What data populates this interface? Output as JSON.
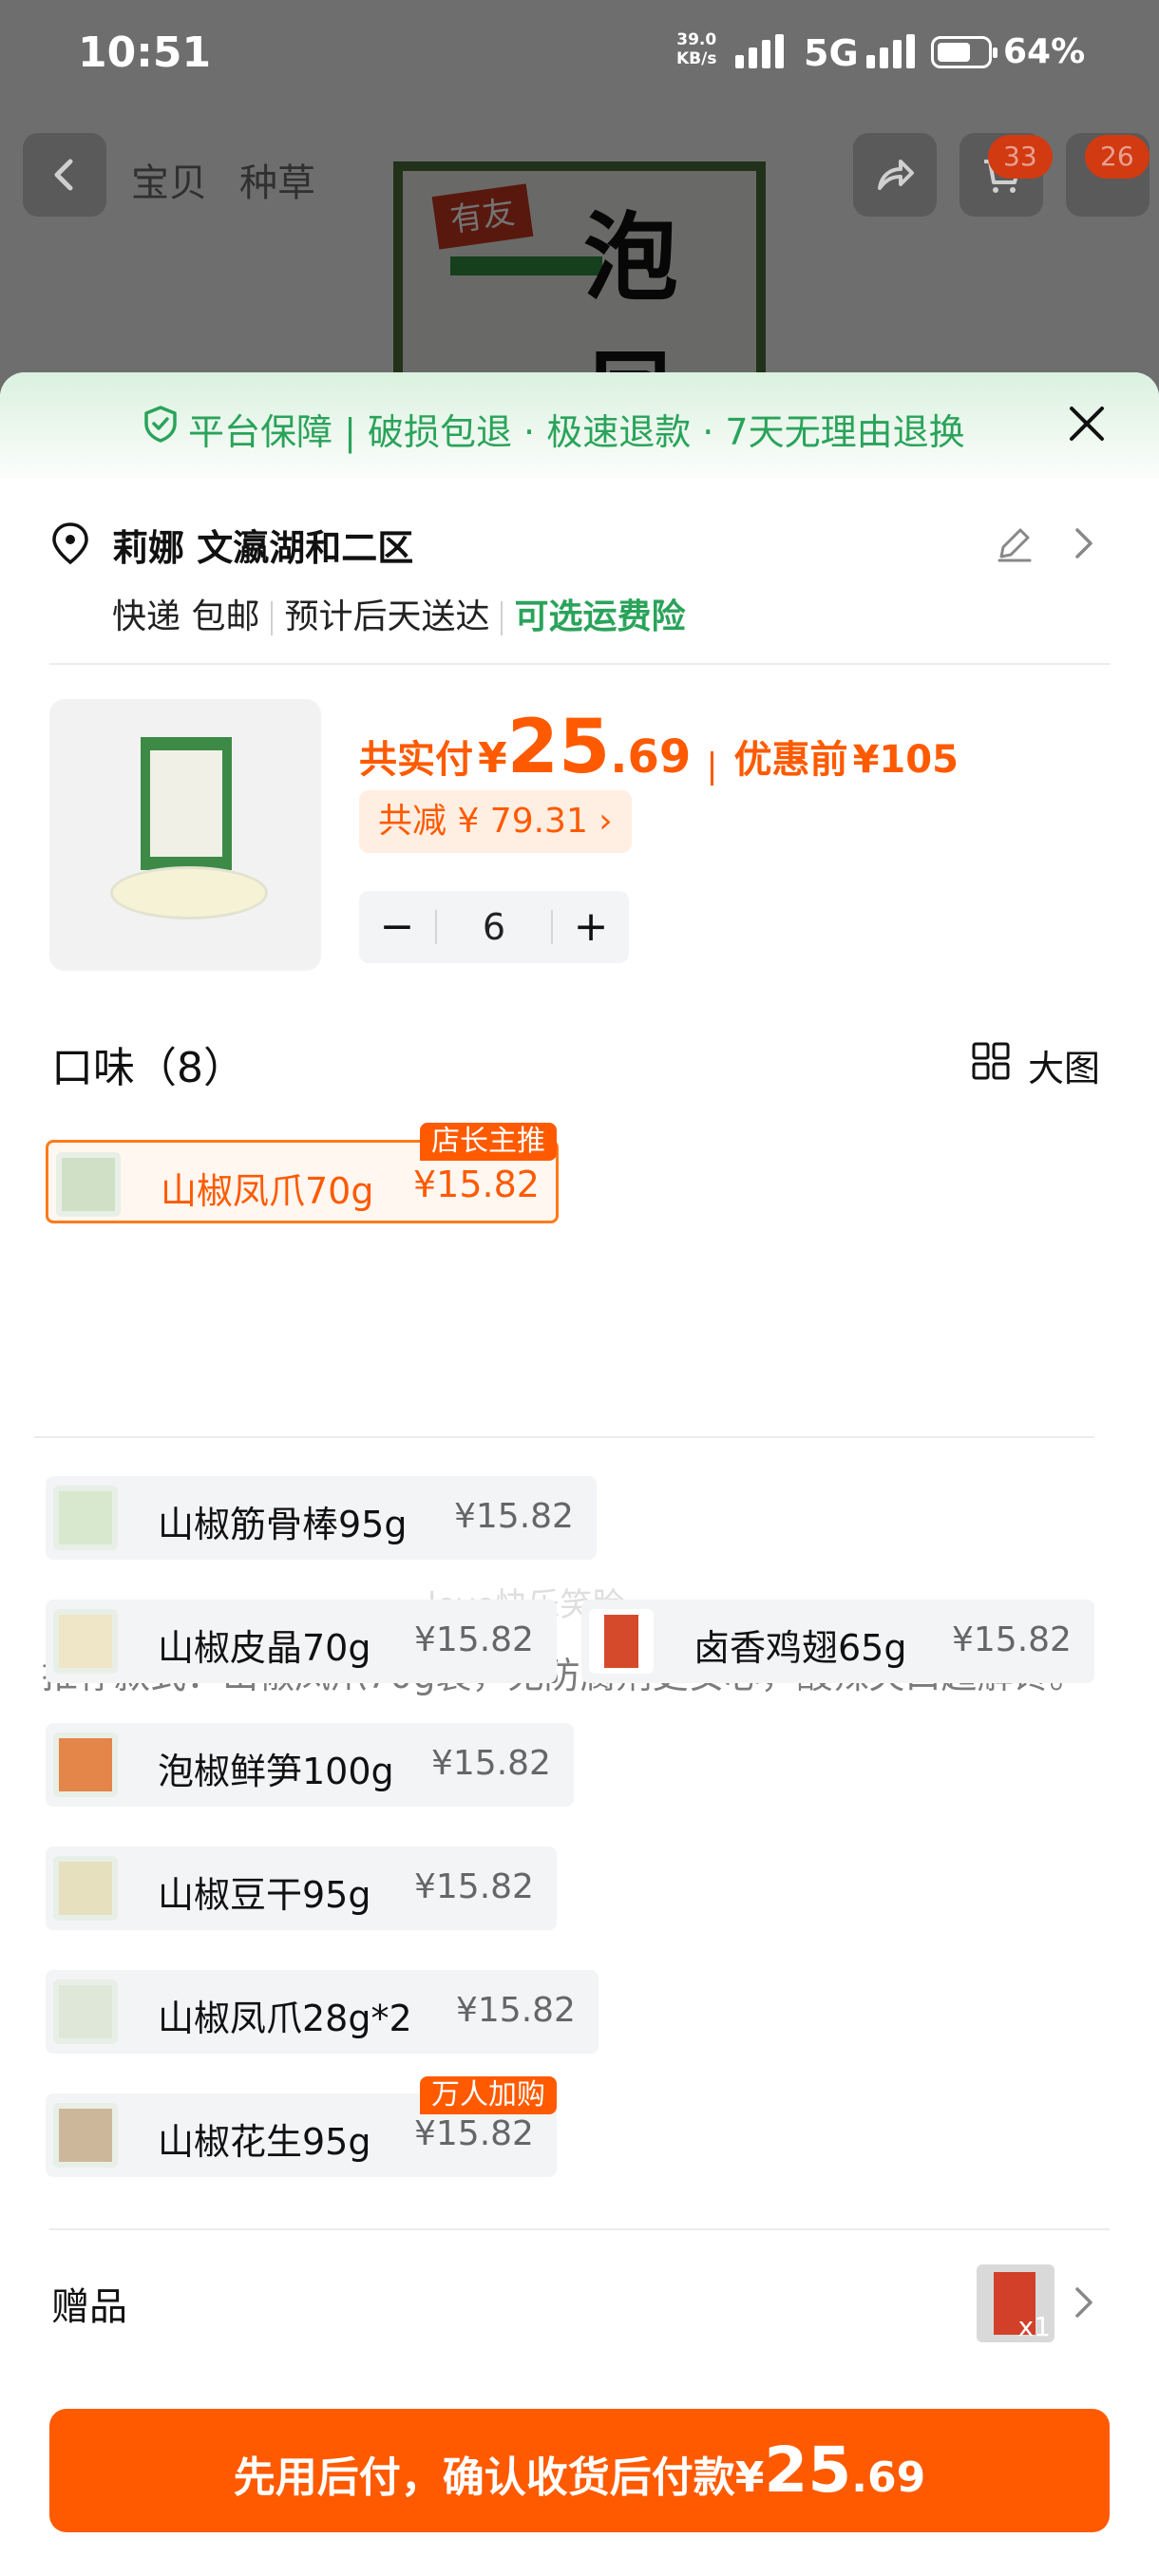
{
  "status_bar": {
    "time": "10:51",
    "net_speed_value": "39.0",
    "net_speed_unit": "KB/s",
    "network": "5G",
    "battery": "64%"
  },
  "background_page": {
    "tabs": [
      "宝贝",
      "种草"
    ],
    "cart_count": "33",
    "more_count": "26"
  },
  "guarantee": {
    "text": "平台保障 | 破损包退 · 极速退款 · 7天无理由退换"
  },
  "address": {
    "name": "莉娜 文瀛湖和二区",
    "shipping": [
      "快递 包邮",
      "预计后天送达"
    ],
    "insurance": "可选运费险"
  },
  "product": {
    "total_label": "共实付",
    "currency": "¥",
    "price_int": "25",
    "price_dec": ".69",
    "before_label": "优惠前",
    "before_price": "¥105",
    "discount": "共减 ¥ 79.31 ›",
    "quantity": "6",
    "minus": "−",
    "plus": "+"
  },
  "flavors": {
    "title": "口味（8）",
    "big_pic_label": "大图",
    "selected": {
      "name": "山椒凤爪70g",
      "price": "¥15.82",
      "tag": "店长主推"
    },
    "recommend": "推荐款式：山椒凤爪70g装，无防腐剂更安心，酸辣爽口超解馋。",
    "watermark": "love快乐笑脸",
    "options": [
      {
        "name": "山椒筋骨棒95g",
        "price": "¥15.82"
      },
      {
        "name": "山椒皮晶70g",
        "price": "¥15.82"
      },
      {
        "name": "卤香鸡翅65g",
        "price": "¥15.82"
      },
      {
        "name": "泡椒鲜笋100g",
        "price": "¥15.82"
      },
      {
        "name": "山椒豆干95g",
        "price": "¥15.82"
      },
      {
        "name": "山椒凤爪28g*2",
        "price": "¥15.82"
      },
      {
        "name": "山椒花生95g",
        "price": "¥15.82",
        "tag": "万人加购"
      }
    ]
  },
  "gift": {
    "label": "赠品",
    "count": "x1"
  },
  "pay_button": {
    "text": "先用后付，确认收货后付款",
    "currency": "¥",
    "price_int": "25",
    "price_dec": ".69"
  },
  "colors": {
    "accent": "#ff5a00",
    "green": "#2aa35a"
  }
}
